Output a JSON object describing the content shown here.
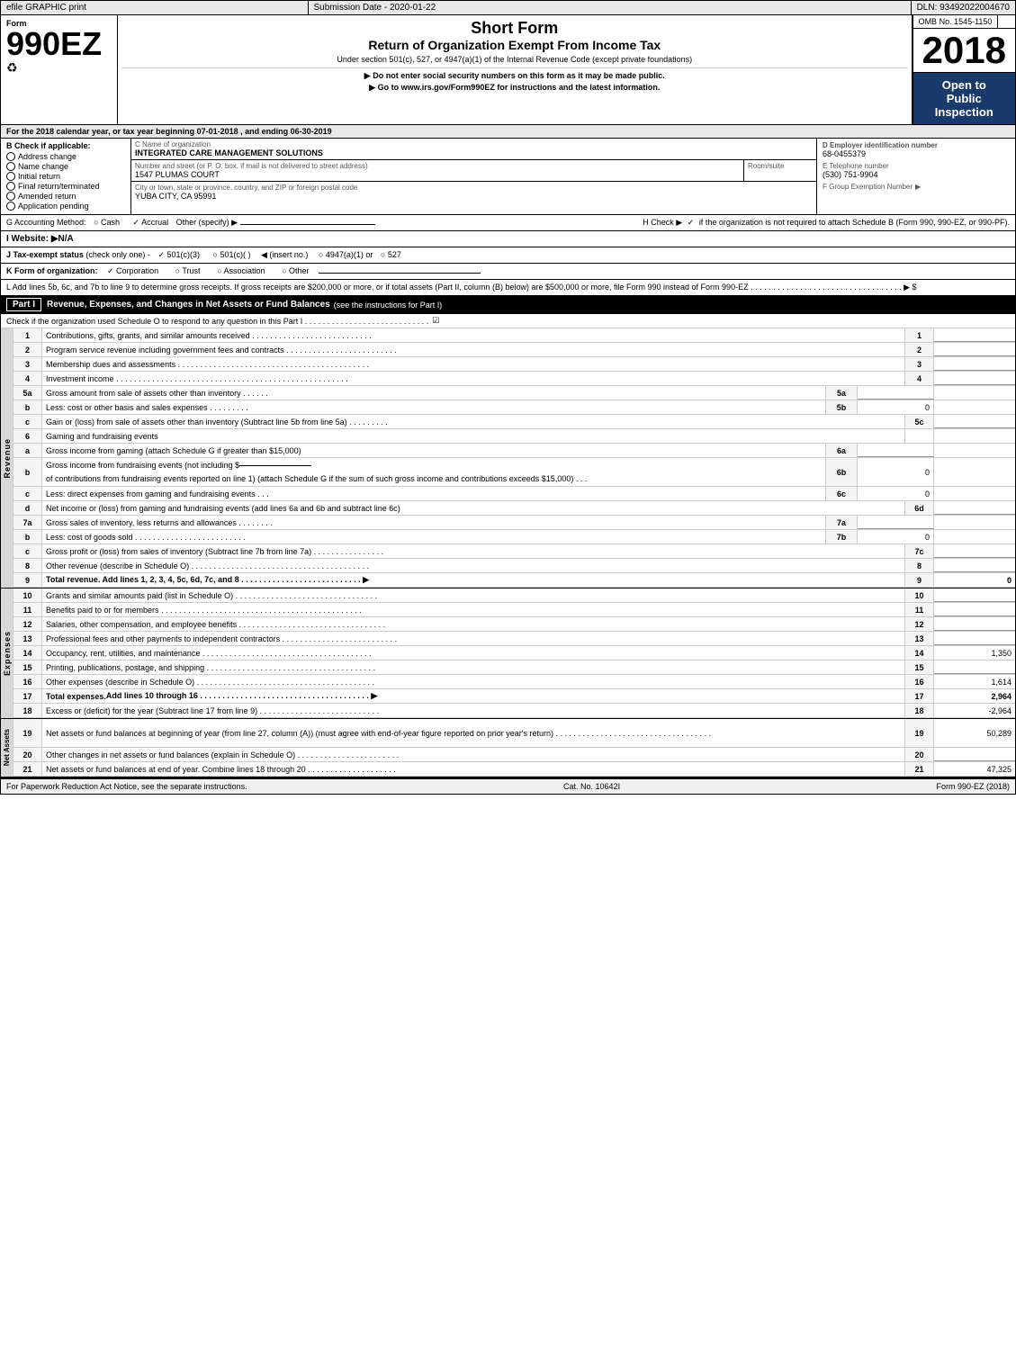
{
  "header": {
    "efile": "efile GRAPHIC print",
    "submission_label": "Submission Date - 2020-01-22",
    "dln": "DLN: 93492022004670",
    "omb": "OMB No. 1545-1150",
    "form_number": "990EZ",
    "form_title": "Short Form",
    "form_subtitle": "Return of Organization Exempt From Income Tax",
    "form_under": "Under section 501(c), 527, or 4947(a)(1) of the Internal Revenue Code (except private foundations)",
    "notice1": "▶ Do not enter social security numbers on this form as it may be made public.",
    "notice2": "▶ Go to www.irs.gov/Form990EZ for instructions and the latest information.",
    "year": "2018",
    "open_to_public": "Open to Public Inspection"
  },
  "tax_year": {
    "text": "For the 2018 calendar year, or tax year beginning 07-01-2018",
    "ending": ", and ending 06-30-2019"
  },
  "check_if": {
    "label": "B Check if applicable:",
    "items": [
      "Address change",
      "Name change",
      "Initial return",
      "Final return/terminated",
      "Amended return",
      "Application pending"
    ]
  },
  "org": {
    "c_label": "C Name of organization",
    "name": "INTEGRATED CARE MANAGEMENT SOLUTIONS",
    "address_label": "Number and street (or P. O. box, if mail is not delivered to street address)",
    "address": "1547 PLUMAS COURT",
    "room_label": "Room/suite",
    "room": "",
    "city_label": "City or town, state or province, country, and ZIP or foreign postal code",
    "city": "YUBA CITY, CA  95991",
    "d_label": "D Employer identification number",
    "ein": "68-0455379",
    "e_label": "E Telephone number",
    "phone": "(530) 751-9904",
    "f_label": "F Group Exemption Number",
    "f_arrow": "▶"
  },
  "accounting": {
    "g_label": "G Accounting Method:",
    "cash": "○ Cash",
    "accrual": "✓ Accrual",
    "other": "Other (specify) ▶",
    "h_label": "H  Check ▶",
    "h_check": "✓",
    "h_text": "if the organization is not required to attach Schedule B (Form 990, 990-EZ, or 990-PF)."
  },
  "website": {
    "i_label": "I Website: ▶N/A"
  },
  "tax_status": {
    "j_label": "J Tax-exempt status",
    "j_note": "(check only one) -",
    "j_501c3": "✓ 501(c)(3)",
    "j_501c": "○ 501(c)(  )",
    "j_insert": "◀ (insert no.)",
    "j_4947": "○ 4947(a)(1) or",
    "j_527": "○ 527"
  },
  "form_org": {
    "k_label": "K Form of organization:",
    "corporation": "✓ Corporation",
    "trust": "○ Trust",
    "association": "○ Association",
    "other": "○ Other"
  },
  "add_lines": {
    "l_text": "L Add lines 5b, 6c, and 7b to line 9 to determine gross receipts. If gross receipts are $200,000 or more, or if total assets (Part II, column (B) below) are $500,000 or more, file Form 990 instead of Form 990-EZ . . . . . . . . . . . . . . . . . . . . . . . . . . . . . . . . . . ▶ $"
  },
  "part1": {
    "label": "Part I",
    "title": "Revenue, Expenses, and Changes in Net Assets or Fund Balances",
    "title_note": "(see the instructions for Part I)",
    "check_line": "Check if the organization used Schedule O to respond to any question in this Part I . . . . . . . . . . . . . . . . . . . . . . . . . . . .",
    "check_val": "☑",
    "lines": [
      {
        "num": "1",
        "desc": "Contributions, gifts, grants, and similar amounts received . . . . . . . . . . . . . . . . . . . . . . . . . . .",
        "col": "1",
        "val": ""
      },
      {
        "num": "2",
        "desc": "Program service revenue including government fees and contracts . . . . . . . . . . . . . . . . . . . . . . . . .",
        "col": "2",
        "val": ""
      },
      {
        "num": "3",
        "desc": "Membership dues and assessments . . . . . . . . . . . . . . . . . . . . . . . . . . . . . . . . . . . . . . . . . . .",
        "col": "3",
        "val": ""
      },
      {
        "num": "4",
        "desc": "Investment income . . . . . . . . . . . . . . . . . . . . . . . . . . . . . . . . . . . . . . . . . . . . . . . . . . . .",
        "col": "4",
        "val": ""
      }
    ],
    "line5a": {
      "num": "5a",
      "desc": "Gross amount from sale of assets other than inventory . . . . . .",
      "col": "5a",
      "val": ""
    },
    "line5b": {
      "num": "b",
      "desc": "Less: cost or other basis and sales expenses . . . . . . . . .",
      "col": "5b",
      "val": "0"
    },
    "line5c": {
      "num": "c",
      "desc": "Gain or (loss) from sale of assets other than inventory (Subtract line 5b from line 5a) . . . . . . . . .",
      "col": "5c",
      "val": ""
    },
    "line6": {
      "num": "6",
      "desc": "Gaming and fundraising events",
      "col": "",
      "val": ""
    },
    "line6a": {
      "num": "a",
      "desc": "Gross income from gaming (attach Schedule G if greater than $15,000)",
      "col": "6a",
      "val": ""
    },
    "line6b": {
      "num": "b",
      "desc_parts": [
        "Gross income from fundraising events (not including $",
        " of contributions from fundraising events reported on line 1) (attach Schedule G if the sum of such gross income and contributions exceeds $15,000)"
      ],
      "col": "6b",
      "val": "0"
    },
    "line6c": {
      "num": "c",
      "desc": "Less: direct expenses from gaming and fundraising events . . .",
      "col": "6c",
      "val": "0"
    },
    "line6d": {
      "num": "d",
      "desc": "Net income or (loss) from gaming and fundraising events (add lines 6a and 6b and subtract line 6c)",
      "col": "6d",
      "val": ""
    },
    "line7a": {
      "num": "7a",
      "desc": "Gross sales of inventory, less returns and allowances . . . . . . . .",
      "col": "7a",
      "val": ""
    },
    "line7b": {
      "num": "b",
      "desc": "Less: cost of goods sold . . . . . . . . . . . . . . . . . . . . . . . . .",
      "col": "7b",
      "val": "0"
    },
    "line7c": {
      "num": "c",
      "desc": "Gross profit or (loss) from sales of inventory (Subtract line 7b from line 7a) . . . . . . . . . . . . . . . .",
      "col": "7c",
      "val": ""
    },
    "line8": {
      "num": "8",
      "desc": "Other revenue (describe in Schedule O) . . . . . . . . . . . . . . . . . . . . . . . . . . . . . . . . . . . . . . . .",
      "col": "8",
      "val": ""
    },
    "line9": {
      "num": "9",
      "desc": "Total revenue. Add lines 1, 2, 3, 4, 5c, 6d, 7c, and 8 . . . . . . . . . . . . . . . . . . . . . . . . . . . ▶",
      "col": "9",
      "val": "0",
      "bold": true
    },
    "expenses": [
      {
        "num": "10",
        "desc": "Grants and similar amounts paid (list in Schedule O) . . . . . . . . . . . . . . . . . . . . . . . . . . . . . . . .",
        "col": "10",
        "val": ""
      },
      {
        "num": "11",
        "desc": "Benefits paid to or for members . . . . . . . . . . . . . . . . . . . . . . . . . . . . . . . . . . . . . . . . . . . . .",
        "col": "11",
        "val": ""
      },
      {
        "num": "12",
        "desc": "Salaries, other compensation, and employee benefits . . . . . . . . . . . . . . . . . . . . . . . . . . . . . . . . .",
        "col": "12",
        "val": ""
      },
      {
        "num": "13",
        "desc": "Professional fees and other payments to independent contractors . . . . . . . . . . . . . . . . . . . . . . . . . .",
        "col": "13",
        "val": ""
      },
      {
        "num": "14",
        "desc": "Occupancy, rent, utilities, and maintenance . . . . . . . . . . . . . . . . . . . . . . . . . . . . . . . . . . . . . .",
        "col": "14",
        "val": "1,350"
      },
      {
        "num": "15",
        "desc": "Printing, publications, postage, and shipping . . . . . . . . . . . . . . . . . . . . . . . . . . . . . . . . . . . . . .",
        "col": "15",
        "val": ""
      },
      {
        "num": "16",
        "desc": "Other expenses (describe in Schedule O) . . . . . . . . . . . . . . . . . . . . . . . . . . . . . . . . . . . . . . . .",
        "col": "16",
        "val": "1,614"
      }
    ],
    "line17": {
      "num": "17",
      "desc": "Total expenses. Add lines 10 through 16 . . . . . . . . . . . . . . . . . . . . . . . . . . . . . . . . . . . . . . ▶",
      "col": "17",
      "val": "2,964",
      "bold": true
    },
    "line18": {
      "num": "18",
      "desc": "Excess or (deficit) for the year (Subtract line 17 from line 9) . . . . . . . . . . . . . . . . . . . . . . . . . . .",
      "col": "18",
      "val": "-2,964"
    },
    "net_assets": [
      {
        "num": "19",
        "desc": "Net assets or fund balances at beginning of year (from line 27, column (A)) (must agree with end-of-year figure reported on prior year's return) . . . . . . . . . . . . . . . . . . . . . . . . . . . . . . . . . . .",
        "col": "19",
        "val": "50,289"
      },
      {
        "num": "20",
        "desc": "Other changes in net assets or fund balances (explain in Schedule O) . . . . . . . . . . . . . . . . . . . . . . .",
        "col": "20",
        "val": ""
      },
      {
        "num": "21",
        "desc": "Net assets or fund balances at end of year. Combine lines 18 through 20 . . . . . . . . . . . . . . . . . . . .",
        "col": "21",
        "val": "47,325"
      }
    ]
  },
  "footer": {
    "left": "For Paperwork Reduction Act Notice, see the separate instructions.",
    "center": "Cat. No. 10642I",
    "right": "Form 990-EZ (2018)"
  }
}
